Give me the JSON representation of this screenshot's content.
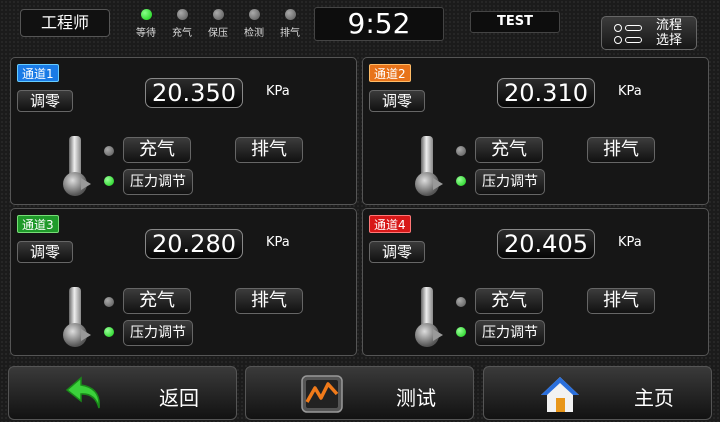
{
  "header": {
    "role": "工程师",
    "steps": [
      {
        "label": "等待",
        "active": true
      },
      {
        "label": "充气",
        "active": false
      },
      {
        "label": "保压",
        "active": false
      },
      {
        "label": "检测",
        "active": false
      },
      {
        "label": "排气",
        "active": false
      }
    ],
    "time": "9:52",
    "mode": "TEST",
    "flow_select_label": "流程\n选择"
  },
  "panels": [
    {
      "channel": "通道1",
      "tag_color": "#1a7be6",
      "zero_label": "调零",
      "pressure": "20.350",
      "unit": "KPa",
      "fill_label": "充气",
      "exhaust_label": "排气",
      "regulate_label": "压力调节",
      "fill_active": false,
      "regulate_active": true
    },
    {
      "channel": "通道2",
      "tag_color": "#e8731a",
      "zero_label": "调零",
      "pressure": "20.310",
      "unit": "KPa",
      "fill_label": "充气",
      "exhaust_label": "排气",
      "regulate_label": "压力调节",
      "fill_active": false,
      "regulate_active": true
    },
    {
      "channel": "通道3",
      "tag_color": "#1f9a2a",
      "zero_label": "调零",
      "pressure": "20.280",
      "unit": "KPa",
      "fill_label": "充气",
      "exhaust_label": "排气",
      "regulate_label": "压力调节",
      "fill_active": false,
      "regulate_active": true
    },
    {
      "channel": "通道4",
      "tag_color": "#d81818",
      "zero_label": "调零",
      "pressure": "20.405",
      "unit": "KPa",
      "fill_label": "充气",
      "exhaust_label": "排气",
      "regulate_label": "压力调节",
      "fill_active": false,
      "regulate_active": true
    }
  ],
  "footer": {
    "back": {
      "label": "返回",
      "icon": "green-back-arrow-icon"
    },
    "test": {
      "label": "测试",
      "icon": "test-chart-icon"
    },
    "home": {
      "label": "主页",
      "icon": "home-icon"
    }
  },
  "colors": {
    "led_on": "#22cc22",
    "led_off": "#888888",
    "accent_orange": "#f07a1a"
  }
}
